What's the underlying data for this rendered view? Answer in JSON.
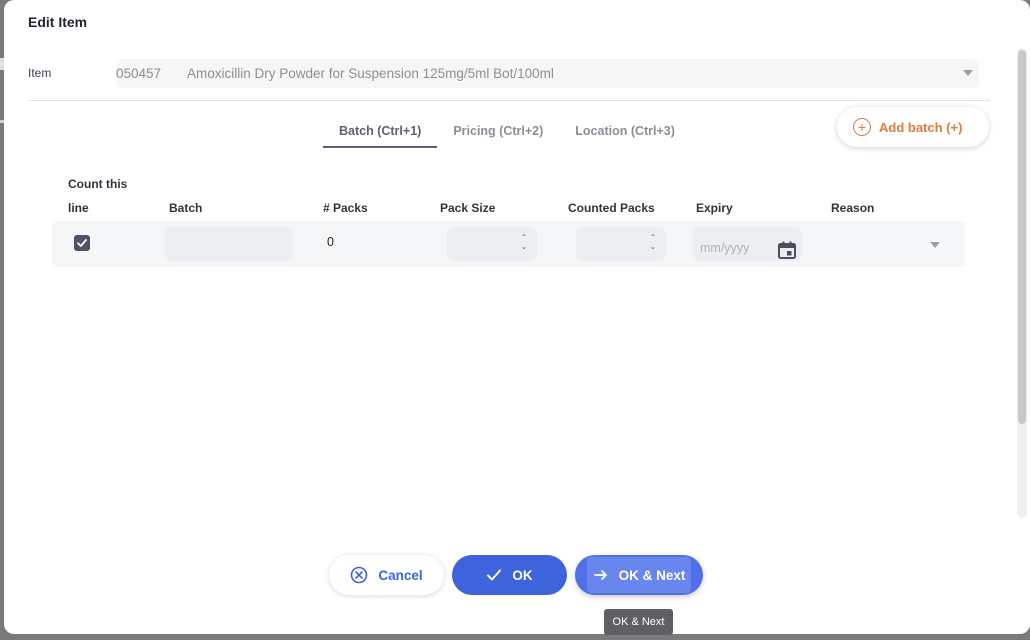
{
  "dialog": {
    "title": "Edit Item",
    "item_label": "Item",
    "item_code": "050457",
    "item_name": "Amoxicillin Dry Powder for Suspension 125mg/5ml Bot/100ml"
  },
  "tabs": [
    {
      "label": "Batch (Ctrl+1)",
      "active": true
    },
    {
      "label": "Pricing (Ctrl+2)",
      "active": false
    },
    {
      "label": "Location (Ctrl+3)",
      "active": false
    }
  ],
  "add_batch_label": "Add batch (+)",
  "table": {
    "headers": {
      "count_line_1": "Count this",
      "count_line_2": "line",
      "batch": "Batch",
      "packs": "# Packs",
      "pack_size": "Pack Size",
      "counted_packs": "Counted Packs",
      "expiry": "Expiry",
      "reason": "Reason"
    },
    "row": {
      "count_this_line": true,
      "batch": "",
      "packs": "0",
      "pack_size": "",
      "counted_packs": "",
      "expiry_placeholder": "mm/yyyy",
      "reason": ""
    }
  },
  "buttons": {
    "cancel": "Cancel",
    "ok": "OK",
    "ok_next": "OK & Next"
  },
  "tooltip": "OK & Next",
  "colors": {
    "primary": "#3e63dd",
    "accent": "#e07a3d"
  }
}
